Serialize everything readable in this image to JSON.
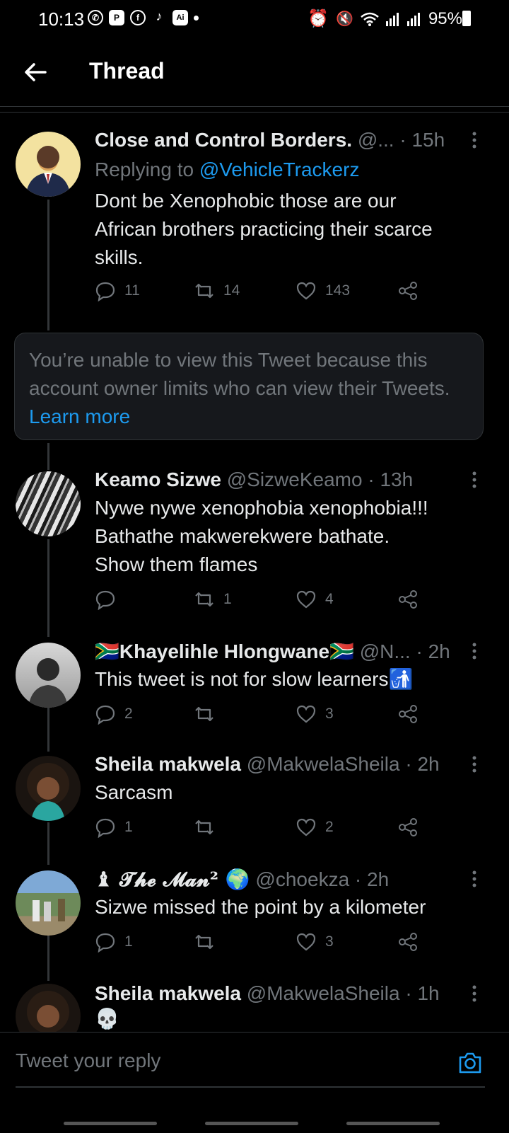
{
  "status_bar": {
    "time": "10:13",
    "battery": "95%"
  },
  "header": {
    "title": "Thread"
  },
  "tweets": [
    {
      "name": "Close and Control Borders.",
      "handle": "@...",
      "sep": "·",
      "time": "15h",
      "replying_prefix": "Replying to",
      "replying_to": "@VehicleTrackerz",
      "text_lines": [
        "Dont be Xenophobic those are our",
        "African brothers practicing their scarce",
        "skills."
      ],
      "replies": "11",
      "retweets": "14",
      "likes": "143"
    },
    {
      "name": "Keamo Sizwe",
      "handle": "@SizweKeamo",
      "sep": "·",
      "time": "13h",
      "text_lines": [
        "Nywe nywe xenophobia xenophobia!!!",
        "Bathathe makwerekwere bathate.",
        "Show them flames"
      ],
      "replies": "",
      "retweets": "1",
      "likes": "4"
    },
    {
      "name": "🇿🇦Khayelihle Hlongwane🇿🇦",
      "handle": "@N...",
      "sep": "·",
      "time": "2h",
      "text_lines": [
        "This tweet is not for slow learners🚮"
      ],
      "replies": "2",
      "retweets": "",
      "likes": "3"
    },
    {
      "name": "Sheila makwela",
      "handle": "@MakwelaSheila",
      "sep": "·",
      "time": "2h",
      "text_lines": [
        "Sarcasm"
      ],
      "replies": "1",
      "retweets": "",
      "likes": "2"
    },
    {
      "name": "♝ 𝓣𝓱𝓮 𝓜𝓪𝓷² 🌍",
      "handle": "@choekza",
      "sep": "·",
      "time": "2h",
      "text_lines": [
        "Sizwe missed the point by a kilometer"
      ],
      "replies": "1",
      "retweets": "",
      "likes": "3"
    },
    {
      "name": "Sheila makwela",
      "handle": "@MakwelaSheila",
      "sep": "·",
      "time": "1h",
      "text_lines": [
        "💀"
      ]
    }
  ],
  "notice": {
    "text": "You’re unable to view this Tweet because this account owner limits who can view their Tweets.",
    "link": "Learn more"
  },
  "reply_bar": {
    "placeholder": "Tweet your reply"
  },
  "icons": {
    "back": "arrow-left-icon",
    "more": "more-vertical-icon",
    "reply": "reply-icon",
    "retweet": "retweet-icon",
    "like": "heart-icon",
    "share": "share-icon",
    "camera": "camera-icon"
  },
  "colors": {
    "accent": "#1d9bf0",
    "background": "#000000",
    "muted": "#71767b",
    "text": "#e7e9ea"
  }
}
